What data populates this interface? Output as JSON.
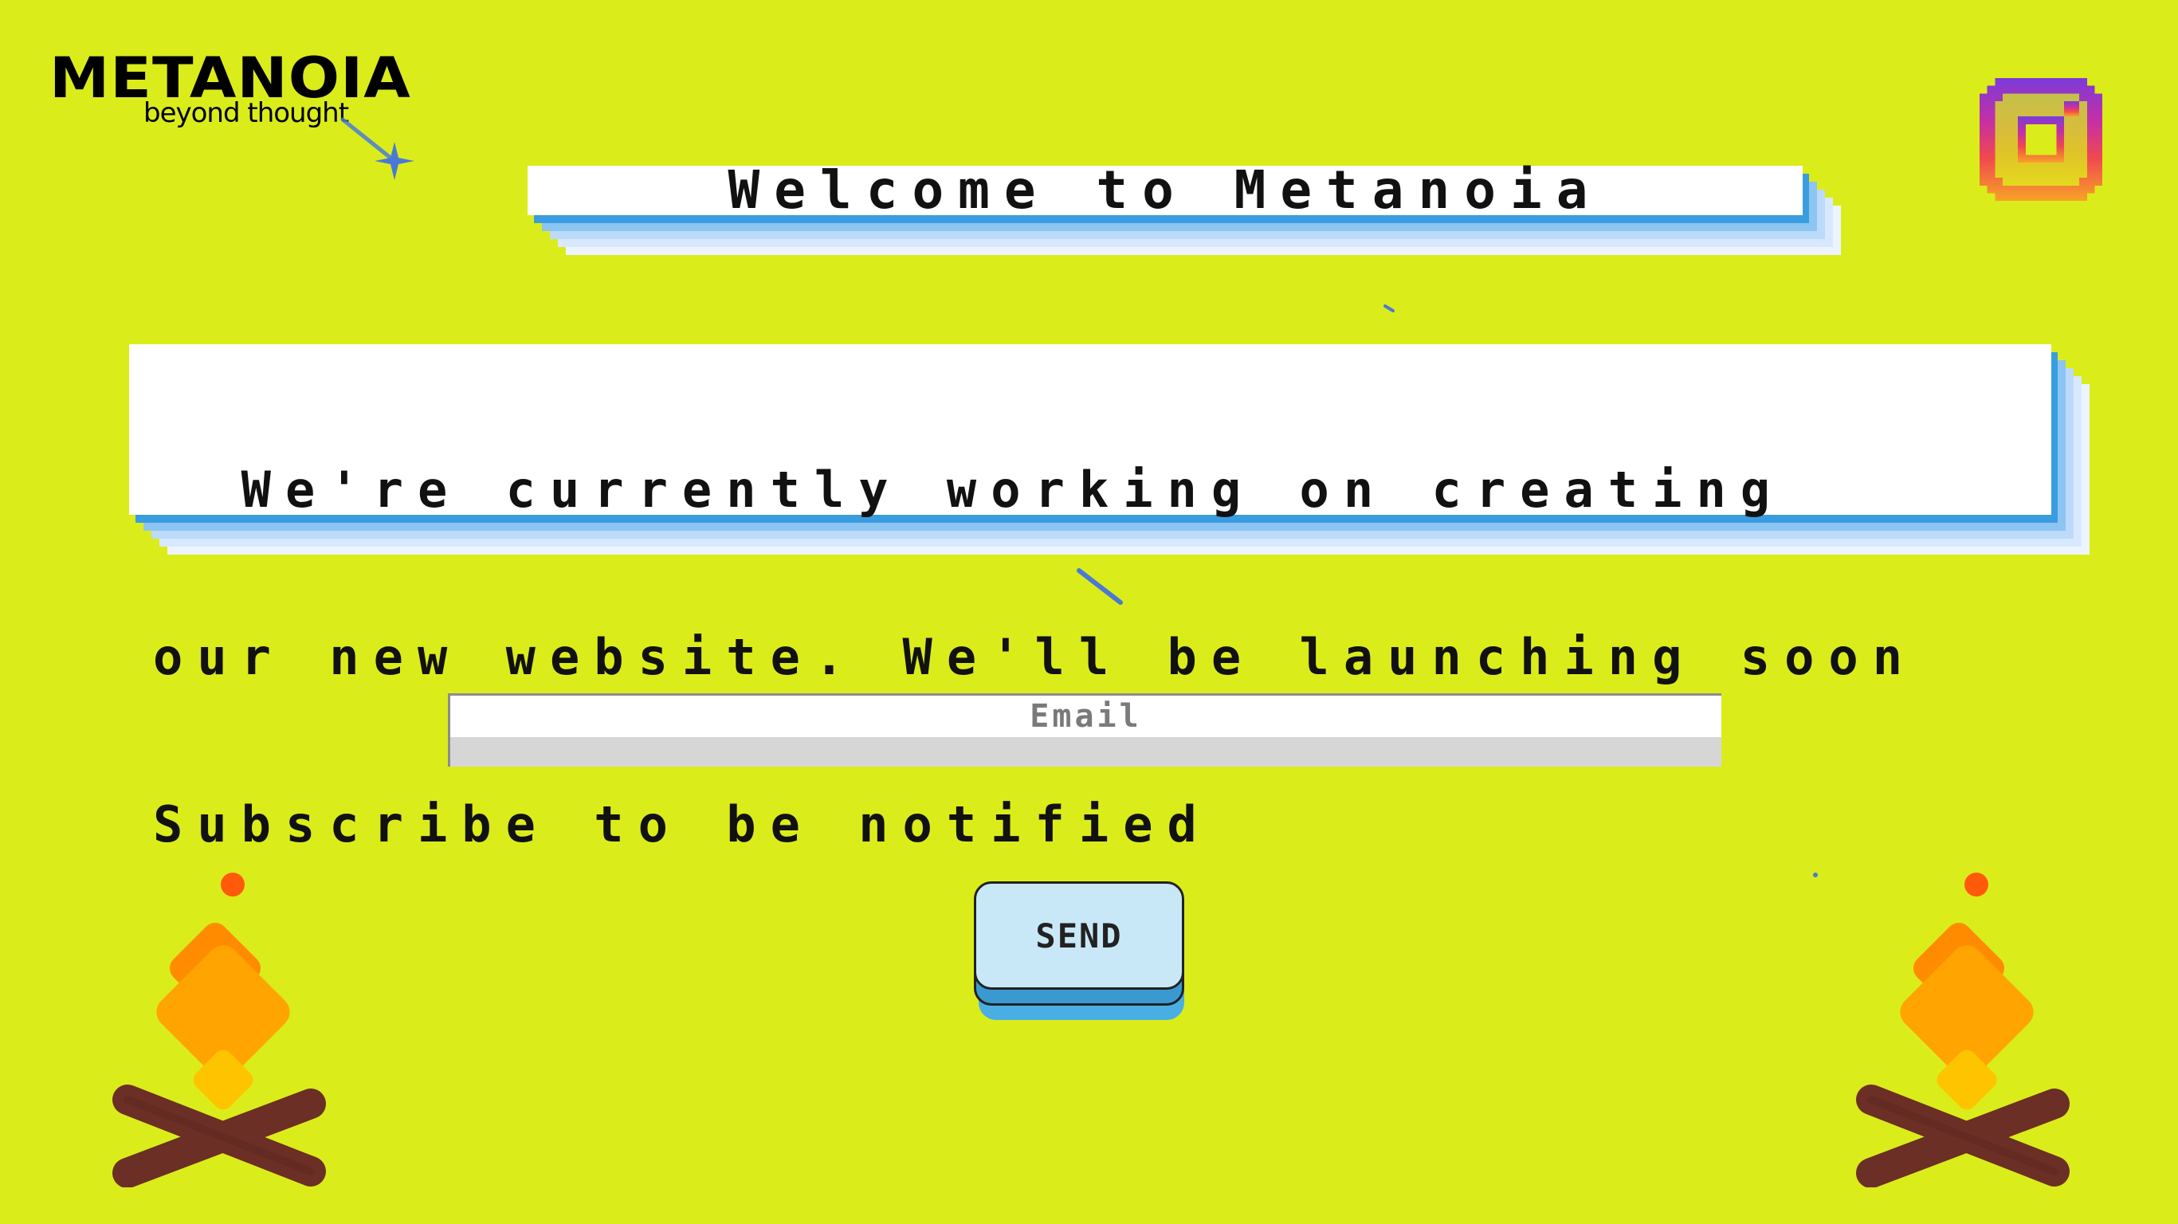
{
  "brand": {
    "name": "METANOIA",
    "tagline": "beyond thought"
  },
  "header": {
    "welcome_text": "Welcome to Metanoia"
  },
  "main": {
    "message_lines": [
      "  We're currently working on creating",
      "our new website. We'll be launching soon",
      "Subscribe to be notified"
    ]
  },
  "form": {
    "email_placeholder": "Email",
    "email_value": "",
    "send_label": "SEND"
  },
  "social": {
    "instagram_icon": "instagram-icon"
  },
  "colors": {
    "background": "#dbec1b",
    "panel_shadow": "#3a9de0",
    "button_fill": "#c9e8f7",
    "fire_orange": "#ffa400",
    "log_brown": "#6b2f25"
  }
}
